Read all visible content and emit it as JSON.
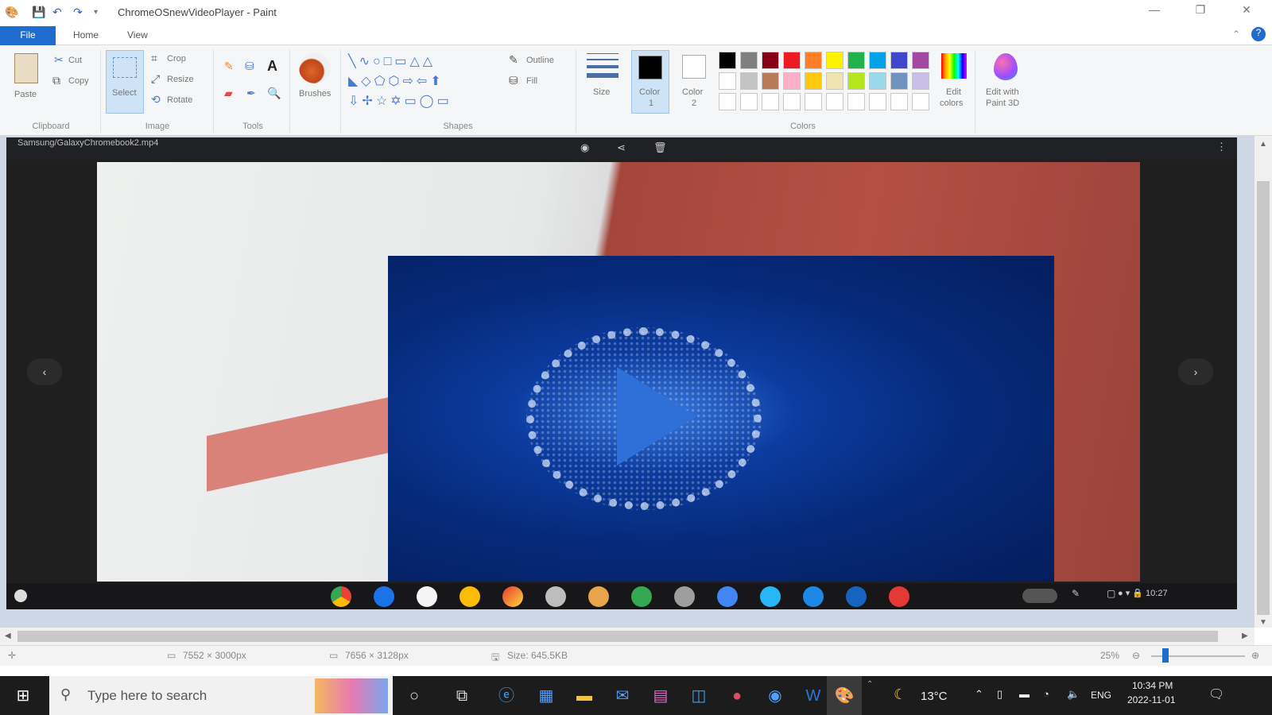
{
  "window": {
    "title": "ChromeOSnewVideoPlayer - Paint",
    "minimize": "—",
    "restore": "❐",
    "close": "✕"
  },
  "tabs": [
    "File",
    "Home",
    "View"
  ],
  "ribbon": {
    "clipboard": {
      "paste": "Paste",
      "cut": "Cut",
      "copy": "Copy",
      "label": "Clipboard"
    },
    "image": {
      "select": "Select",
      "crop": "Crop",
      "resize": "Resize",
      "rotate": "Rotate",
      "label": "Image"
    },
    "tools": {
      "label": "Tools"
    },
    "brushes": {
      "label": "Brushes"
    },
    "shapes": {
      "outline": "Outline",
      "fill": "Fill",
      "label": "Shapes"
    },
    "size": {
      "label": "Size"
    },
    "color1": {
      "label": "Color",
      "num": "1"
    },
    "color2": {
      "label": "Color",
      "num": "2"
    },
    "colors": {
      "label": "Colors",
      "row1": [
        "#000000",
        "#7f7f7f",
        "#880015",
        "#ed1c24",
        "#ff7f27",
        "#fff200",
        "#22b14c",
        "#00a2e8",
        "#3f48cc",
        "#a349a4"
      ],
      "row2": [
        "#ffffff",
        "#c3c3c3",
        "#b97a57",
        "#ffaec9",
        "#ffc90e",
        "#efe4b0",
        "#b5e61d",
        "#99d9ea",
        "#7092be",
        "#c8bfe7"
      ],
      "row3": [
        "#ffffff",
        "#ffffff",
        "#ffffff",
        "#ffffff",
        "#ffffff",
        "#ffffff",
        "#ffffff",
        "#ffffff",
        "#ffffff",
        "#ffffff"
      ]
    },
    "edit_colors": {
      "line1": "Edit",
      "line2": "colors"
    },
    "paint3d": {
      "line1": "Edit with",
      "line2": "Paint 3D"
    }
  },
  "player": {
    "filename": "Samsung/GalaxyChromebook2.mp4",
    "prev": "‹",
    "next": "›",
    "time": "10:27"
  },
  "statusbar": {
    "dimensions": "7552 × 3000px",
    "selection": "7656 × 3128px",
    "size": "Size: 645.5KB",
    "zoom": "25%"
  },
  "taskbar": {
    "search_placeholder": "Type here to search",
    "weather": "13°C",
    "lang": "ENG",
    "time": "10:34 PM",
    "date": "2022-11-01"
  }
}
